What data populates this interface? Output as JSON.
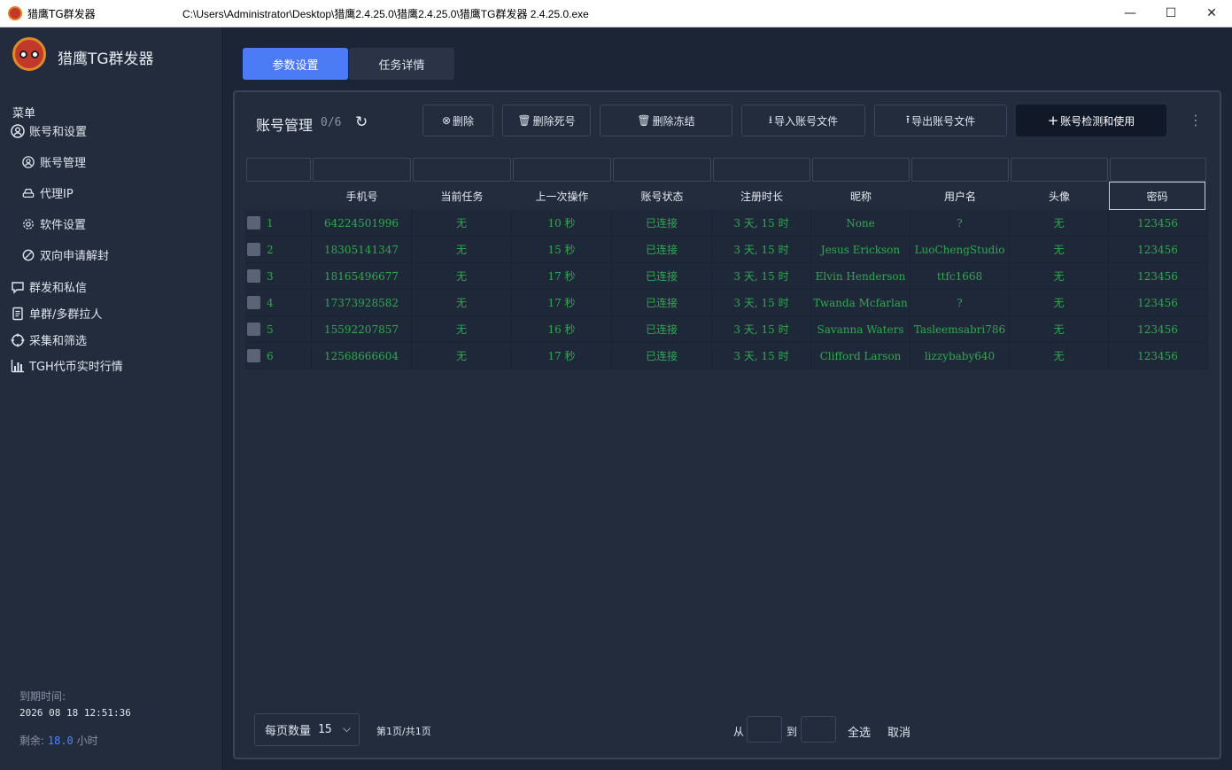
{
  "window": {
    "app_name": "猎鹰TG群发器",
    "path": "C:\\Users\\Administrator\\Desktop\\猎鹰2.4.25.0\\猎鹰2.4.25.0\\猎鹰TG群发器 2.4.25.0.exe",
    "minimize": "—",
    "maximize": "☐",
    "close": "✕"
  },
  "sidebar": {
    "brand": "猎鹰TG群发器",
    "menu_title": "菜单",
    "items": [
      {
        "label": "账号和设置",
        "icon": "user-circle-icon"
      },
      {
        "label": "账号管理",
        "icon": "user-circle-icon"
      },
      {
        "label": "代理IP",
        "icon": "drive-icon"
      },
      {
        "label": "软件设置",
        "icon": "gear-icon"
      },
      {
        "label": "双向申请解封",
        "icon": "ban-icon"
      },
      {
        "label": "群发和私信",
        "icon": "chat-icon"
      },
      {
        "label": "单群/多群拉人",
        "icon": "document-icon"
      },
      {
        "label": "采集和筛选",
        "icon": "crosshair-icon"
      },
      {
        "label": "TGH代币实时行情",
        "icon": "bar-chart-icon"
      }
    ],
    "expire_label": "到期时间:",
    "expire_date": "2026 08 18 12:51:36",
    "remain_label": "剩余:",
    "remain_value": "18.0",
    "remain_unit": "小时"
  },
  "tabs": [
    {
      "label": "参数设置",
      "active": true
    },
    {
      "label": "任务详情",
      "active": false
    }
  ],
  "panel": {
    "title": "账号管理",
    "count": "0/6",
    "buttons": {
      "delete": "删除",
      "delete_dead": "删除死号",
      "delete_frozen": "删除冻结",
      "import": "导入账号文件",
      "export": "导出账号文件",
      "check": "账号检测和使用"
    }
  },
  "table": {
    "columns": [
      "手机号",
      "当前任务",
      "上一次操作",
      "账号状态",
      "注册时长",
      "昵称",
      "用户名",
      "头像",
      "密码"
    ],
    "rows": [
      {
        "idx": "1",
        "phone": "64224501996",
        "task": "无",
        "last": "10 秒",
        "status": "已连接",
        "age": "3 天, 15 时",
        "nick": "None",
        "user": "?",
        "avatar": "无",
        "pwd": "123456"
      },
      {
        "idx": "2",
        "phone": "18305141347",
        "task": "无",
        "last": "15 秒",
        "status": "已连接",
        "age": "3 天, 15 时",
        "nick": "Jesus Erickson",
        "user": "LuoChengStudio",
        "avatar": "无",
        "pwd": "123456"
      },
      {
        "idx": "3",
        "phone": "18165496677",
        "task": "无",
        "last": "17 秒",
        "status": "已连接",
        "age": "3 天, 15 时",
        "nick": "Elvin Henderson",
        "user": "ttfc1668",
        "avatar": "无",
        "pwd": "123456"
      },
      {
        "idx": "4",
        "phone": "17373928582",
        "task": "无",
        "last": "17 秒",
        "status": "已连接",
        "age": "3 天, 15 时",
        "nick": "Twanda Mcfarlan",
        "user": "?",
        "avatar": "无",
        "pwd": "123456"
      },
      {
        "idx": "5",
        "phone": "15592207857",
        "task": "无",
        "last": "16 秒",
        "status": "已连接",
        "age": "3 天, 15 时",
        "nick": "Savanna Waters",
        "user": "Tasleemsabri786",
        "avatar": "无",
        "pwd": "123456"
      },
      {
        "idx": "6",
        "phone": "12568666604",
        "task": "无",
        "last": "17 秒",
        "status": "已连接",
        "age": "3 天, 15 时",
        "nick": "Clifford Larson",
        "user": "lizzybaby640",
        "avatar": "无",
        "pwd": "123456"
      }
    ]
  },
  "footer": {
    "per_page_label": "每页数量",
    "per_page_value": "15",
    "page_info": "第1页/共1页",
    "from": "从",
    "to": "到",
    "select_all": "全选",
    "cancel": "取消"
  },
  "colors": {
    "accent": "#4b7bf5",
    "status_green": "#2fa84f",
    "background": "#1c2536",
    "panel": "#222c3d"
  }
}
